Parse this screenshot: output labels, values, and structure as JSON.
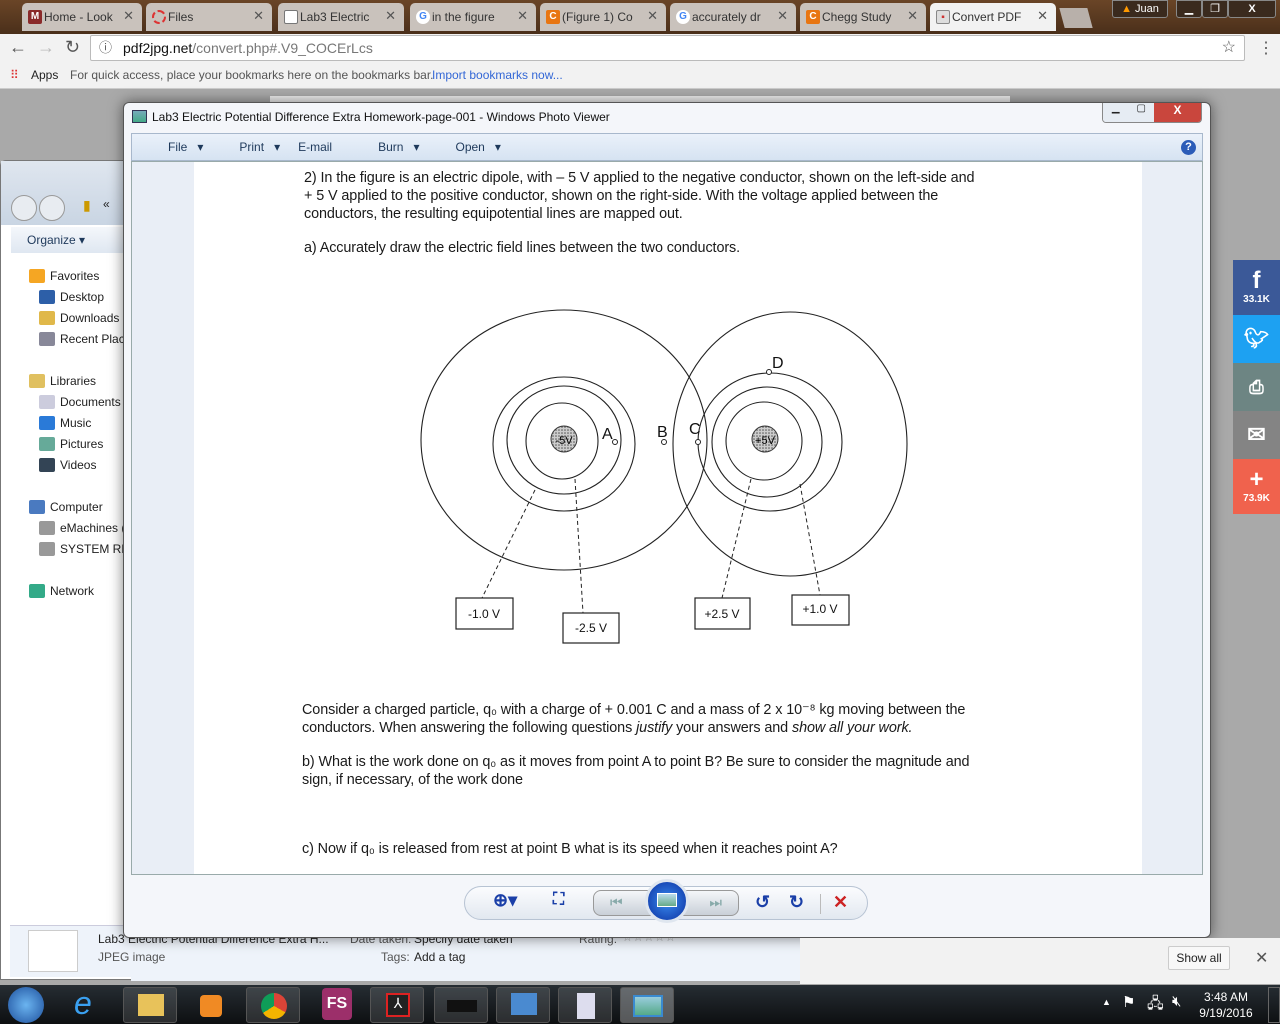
{
  "browser": {
    "tabs": [
      {
        "label": "Home - Look",
        "icon": "mynm-icon",
        "color": "#8a2a2a"
      },
      {
        "label": "Files",
        "icon": "files-ring-icon",
        "color": "#d33"
      },
      {
        "label": "Lab3 Electric",
        "icon": "document-icon",
        "color": "#888"
      },
      {
        "label": "in the figure",
        "icon": "google-icon",
        "color": "#4285f4"
      },
      {
        "label": "(Figure 1) Co",
        "icon": "chegg-icon",
        "color": "#e87511"
      },
      {
        "label": "accurately dr",
        "icon": "google-icon",
        "color": "#4285f4"
      },
      {
        "label": "Chegg Study",
        "icon": "chegg-icon",
        "color": "#e87511"
      },
      {
        "label": "Convert PDF",
        "icon": "pdf2jpg-icon",
        "color": "#c33",
        "active": true
      }
    ],
    "profile": "Juan",
    "url_host": "pdf2jpg.net",
    "url_path": "/convert.php#.V9_COCErLcs",
    "bookmarks": {
      "apps": "Apps",
      "hint": "For quick access, place your bookmarks here on the bookmarks bar.",
      "import": "Import bookmarks now..."
    }
  },
  "explorer": {
    "organize": "Organize",
    "nav": [
      {
        "label": "Favorites",
        "icon": "star-icon"
      },
      {
        "label": "Desktop",
        "icon": "desktop-icon"
      },
      {
        "label": "Downloads",
        "icon": "downloads-icon"
      },
      {
        "label": "Recent Places",
        "icon": "recent-places-icon"
      },
      {
        "label": "Libraries",
        "icon": "libraries-icon"
      },
      {
        "label": "Documents",
        "icon": "documents-icon"
      },
      {
        "label": "Music",
        "icon": "music-icon"
      },
      {
        "label": "Pictures",
        "icon": "pictures-icon"
      },
      {
        "label": "Videos",
        "icon": "videos-icon"
      },
      {
        "label": "Computer",
        "icon": "computer-icon"
      },
      {
        "label": "eMachines (C:)",
        "icon": "drive-icon"
      },
      {
        "label": "SYSTEM RESERVED",
        "icon": "drive-icon"
      },
      {
        "label": "Network",
        "icon": "network-icon"
      }
    ],
    "details": {
      "name": "Lab3 Electric Potential Difference Extra H...",
      "type": "JPEG image",
      "date_label": "Date taken:",
      "date_value": "Specify date taken",
      "tags_label": "Tags:",
      "tags_value": "Add a tag",
      "rating_label": "Rating:",
      "rating": 0
    }
  },
  "photo_viewer": {
    "title": "Lab3 Electric Potential Difference Extra Homework-page-001 - Windows Photo Viewer",
    "menu": [
      "File",
      "Print",
      "E-mail",
      "Burn",
      "Open"
    ],
    "document": {
      "q2": [
        "2) In the figure is an electric dipole, with – 5 V applied to the negative conductor, shown on the left-side and",
        "+ 5 V applied to the positive conductor, shown on the right-side. With the voltage applied between the",
        "conductors, the resulting equipotential lines are mapped out."
      ],
      "qa": "a) Accurately draw the electric field lines between the two conductors.",
      "consider1": "Consider a charged particle, q₀ with a charge of + 0.001 C and a mass of 2 x 10⁻⁸ kg moving between the",
      "consider2a": "conductors. When answering the following questions ",
      "consider2b": "justify",
      "consider2c": " your answers and ",
      "consider2d": "show all your work.",
      "qb": [
        "b) What is the work done on q₀ as it moves from point A to point B? Be sure to consider the magnitude and",
        "sign, if necessary, of the work done"
      ],
      "qc": "c)  Now if q₀ is released from rest at point B what is its speed when it reaches point A?",
      "figure": {
        "neg_conductor": "-5V",
        "pos_conductor": "+5V",
        "points": [
          "A",
          "B",
          "C",
          "D"
        ],
        "labels": [
          "-1.0 V",
          "-2.5 V",
          "+2.5 V",
          "+1.0 V"
        ]
      }
    }
  },
  "social": [
    {
      "icon": "facebook-icon",
      "count": "33.1K",
      "color": "#3b5998"
    },
    {
      "icon": "twitter-icon",
      "color": "#1da1f2"
    },
    {
      "icon": "print-icon",
      "color": "#6d8583"
    },
    {
      "icon": "email-icon",
      "color": "#848484"
    },
    {
      "icon": "plus-icon",
      "count": "73.9K",
      "color": "#f0624d"
    }
  ],
  "downloads_bar": {
    "show_all": "Show all"
  },
  "taskbar": {
    "time": "3:48 AM",
    "date": "9/19/2016"
  }
}
